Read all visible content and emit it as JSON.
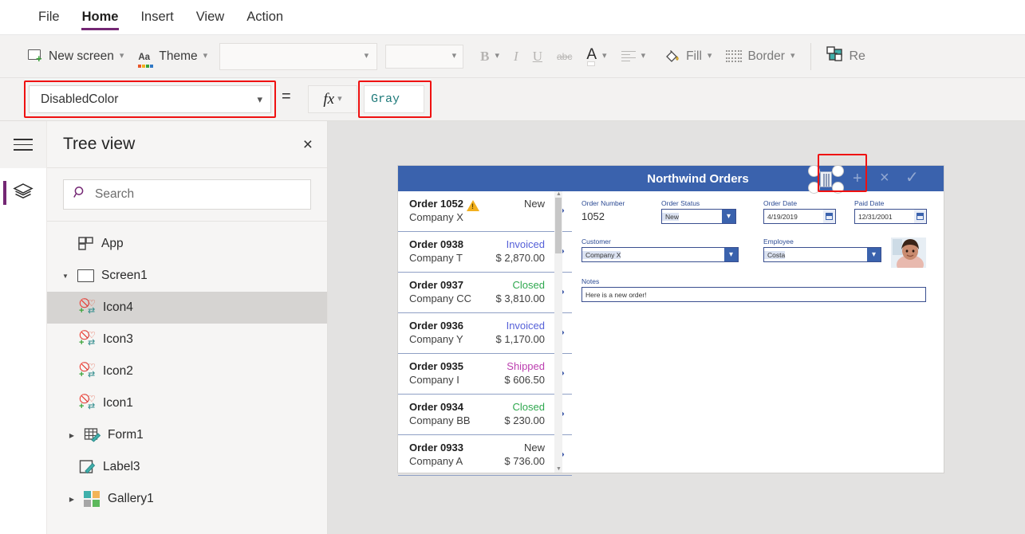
{
  "menu": {
    "items": [
      {
        "label": "File",
        "active": false
      },
      {
        "label": "Home",
        "active": true
      },
      {
        "label": "Insert",
        "active": false
      },
      {
        "label": "View",
        "active": false
      },
      {
        "label": "Action",
        "active": false
      }
    ]
  },
  "ribbon": {
    "new_screen": "New screen",
    "theme": "Theme",
    "font_family_value": "",
    "font_size_value": "",
    "bold": "B",
    "italic": "I",
    "underline": "U",
    "strikethrough": "abc",
    "font_color": "A",
    "align": "align",
    "fill": "Fill",
    "border": "Border",
    "reorder": "Re"
  },
  "formula_bar": {
    "property_selected": "DisabledColor",
    "equals": "=",
    "fx": "fx",
    "formula_value": "Gray",
    "formula_color": "#1f7a7a"
  },
  "tree_panel": {
    "title": "Tree view",
    "close_icon": "×",
    "search_placeholder": "Search",
    "items": [
      {
        "label": "App",
        "icon": "app-icon",
        "indent": 1,
        "twisty": "",
        "selected": false
      },
      {
        "label": "Screen1",
        "icon": "screen-icon",
        "indent": 1,
        "twisty": "▼",
        "selected": false
      },
      {
        "label": "Icon4",
        "icon": "icon-icon",
        "indent": 2,
        "twisty": "",
        "selected": true
      },
      {
        "label": "Icon3",
        "icon": "icon-icon",
        "indent": 2,
        "twisty": "",
        "selected": false
      },
      {
        "label": "Icon2",
        "icon": "icon-icon",
        "indent": 2,
        "twisty": "",
        "selected": false
      },
      {
        "label": "Icon1",
        "icon": "icon-icon",
        "indent": 2,
        "twisty": "",
        "selected": false
      },
      {
        "label": "Form1",
        "icon": "form-icon",
        "indent": 2,
        "twisty": "▶",
        "selected": false
      },
      {
        "label": "Label3",
        "icon": "label-icon",
        "indent": 2,
        "twisty": "",
        "selected": false
      },
      {
        "label": "Gallery1",
        "icon": "gallery-icon",
        "indent": 2,
        "twisty": "▶",
        "selected": false
      }
    ]
  },
  "rail": {
    "hamburger": "menu-icon",
    "layers": "layers-icon"
  },
  "canvas": {
    "gallery": {
      "header_color": "#3a62ad",
      "rows": [
        {
          "order": "Order 1052",
          "company": "Company X",
          "status": "New",
          "status_color": "#3b3b3b",
          "amount": "",
          "warning": true
        },
        {
          "order": "Order 0938",
          "company": "Company T",
          "status": "Invoiced",
          "status_color": "#5560d8",
          "amount": "$ 2,870.00",
          "warning": false
        },
        {
          "order": "Order 0937",
          "company": "Company CC",
          "status": "Closed",
          "status_color": "#2fa84f",
          "amount": "$ 3,810.00",
          "warning": false
        },
        {
          "order": "Order 0936",
          "company": "Company Y",
          "status": "Invoiced",
          "status_color": "#5560d8",
          "amount": "$ 1,170.00",
          "warning": false
        },
        {
          "order": "Order 0935",
          "company": "Company I",
          "status": "Shipped",
          "status_color": "#bc3fb0",
          "amount": "$ 606.50",
          "warning": false
        },
        {
          "order": "Order 0934",
          "company": "Company BB",
          "status": "Closed",
          "status_color": "#2fa84f",
          "amount": "$ 230.00",
          "warning": false
        },
        {
          "order": "Order 0933",
          "company": "Company A",
          "status": "New",
          "status_color": "#3b3b3b",
          "amount": "$ 736.00",
          "warning": false
        }
      ]
    },
    "form": {
      "title": "Northwind Orders",
      "header_icons": [
        "+",
        "×",
        "✓"
      ],
      "fields": {
        "order_number_label": "Order Number",
        "order_number_value": "1052",
        "order_status_label": "Order Status",
        "order_status_value": "New",
        "order_date_label": "Order Date",
        "order_date_value": "4/19/2019",
        "paid_date_label": "Paid Date",
        "paid_date_value": "12/31/2001",
        "customer_label": "Customer",
        "customer_value": "Company X",
        "employee_label": "Employee",
        "employee_value": "Costa",
        "notes_label": "Notes",
        "notes_value": "Here is a new order!"
      }
    }
  },
  "colors": {
    "accent_purple": "#742774",
    "annotation_red": "#ef1111",
    "app_blue": "#3a62ad"
  }
}
